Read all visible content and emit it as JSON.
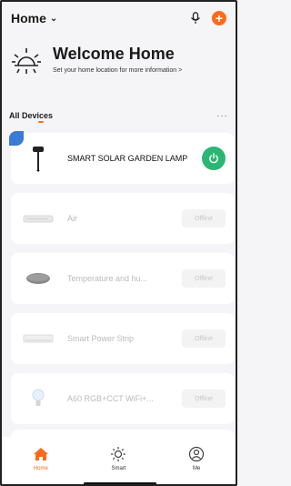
{
  "header": {
    "home_label": "Home",
    "chevron_icon": "chevron-down-icon",
    "mic_icon": "microphone-icon",
    "add_icon": "add-icon",
    "add_color": "#ff6a1a"
  },
  "welcome": {
    "title": "Welcome Home",
    "subtitle": "Set your home location for more information  >",
    "icon": "sun-icon"
  },
  "section": {
    "tab_label": "All Devices",
    "more_label": "···"
  },
  "devices": [
    {
      "name": "SMART SOLAR GARDEN LAMP",
      "icon": "garden-lamp-icon",
      "state": "online",
      "action_icon": "power-icon",
      "accent": "#2bb673"
    },
    {
      "name": "Air",
      "icon": "air-purifier-icon",
      "status": "Offline"
    },
    {
      "name": "Temperature and hu...",
      "icon": "sensor-icon",
      "status": "Offline"
    },
    {
      "name": "Smart Power Strip",
      "icon": "power-strip-icon",
      "status": "Offline"
    },
    {
      "name": "A60 RGB+CCT WiFi+...",
      "icon": "bulb-icon",
      "status": "Offline"
    }
  ],
  "nav": [
    {
      "label": "Home",
      "icon": "home-icon"
    },
    {
      "label": "Smart",
      "icon": "sun-outline-icon"
    },
    {
      "label": "Me",
      "icon": "person-icon"
    }
  ]
}
